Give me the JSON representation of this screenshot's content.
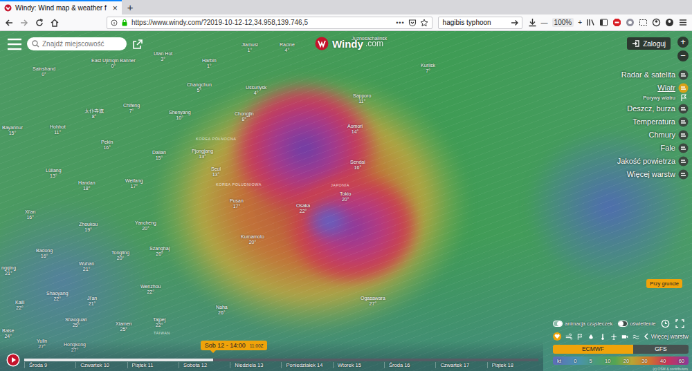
{
  "browser": {
    "tab": {
      "title": "Windy: Wind map & weather f",
      "close": "×",
      "selected": true
    },
    "new_tab": "+",
    "url": "https://www.windy.com/?2019-10-12-12,34.958,139.746,5",
    "page_actions": "•••",
    "search": "hagibis typhoon",
    "zoom_out": "—",
    "zoom_level": "100%",
    "zoom_in": "+"
  },
  "app": {
    "search_placeholder": "Znajdź miejscowość",
    "logo": "Windy",
    "logo_suffix": ".com",
    "login": "Zaloguj",
    "zoom": [
      "+",
      "−"
    ],
    "layers": [
      {
        "label": "Radar & satelita",
        "selected": false,
        "kind": "main"
      },
      {
        "label": "Wiatr",
        "selected": true,
        "kind": "main"
      },
      {
        "label": "Porywy wiatru",
        "selected": false,
        "kind": "sub"
      },
      {
        "label": "Deszcz, burza",
        "selected": false,
        "kind": "main"
      },
      {
        "label": "Temperatura",
        "selected": false,
        "kind": "main"
      },
      {
        "label": "Chmury",
        "selected": false,
        "kind": "main"
      },
      {
        "label": "Fale",
        "selected": false,
        "kind": "main"
      },
      {
        "label": "Jakość powietrza",
        "selected": false,
        "kind": "main"
      },
      {
        "label": "Więcej warstw",
        "selected": false,
        "kind": "main"
      }
    ],
    "level_button": "Przy gruncie",
    "toggles": [
      {
        "label": "animacja cząsteczek",
        "on": true
      },
      {
        "label": "oświetlenie",
        "on": false
      }
    ],
    "more_layers": "Więcej warstw",
    "models": [
      {
        "label": "ECMWF",
        "selected": true
      },
      {
        "label": "GFS",
        "selected": false
      }
    ],
    "legend": {
      "unit": "kt",
      "ticks": [
        "0",
        "5",
        "10",
        "20",
        "30",
        "40",
        "60"
      ]
    },
    "copyright": "(c) OSM & contributors"
  },
  "timeline": {
    "bubble": "Sob 12 - 14:00",
    "bubble_utc": "11:00Z",
    "level": 0.367,
    "days": [
      "Środa 9",
      "Czwartek 10",
      "Piątek 11",
      "Sobota 12",
      "Niedziela 13",
      "Poniedziałek 14",
      "Wtorek 15",
      "Środa 16",
      "Czwartek 17",
      "Piątek 18"
    ]
  },
  "map": {
    "regions": [
      "KOREA PÓŁNOCNA",
      "KOREA POŁUDNIOWA",
      "JAPONIA",
      "TAIWAN"
    ],
    "cities": [
      {
        "name": "Sainshand",
        "temp": "0°"
      },
      {
        "name": "East Ujimqin Banner",
        "temp": "0°"
      },
      {
        "name": "Ulan Hot",
        "temp": "3°"
      },
      {
        "name": "Harbin",
        "temp": "1°"
      },
      {
        "name": "Jiamusi",
        "temp": "1°"
      },
      {
        "name": "Racine",
        "temp": "4°"
      },
      {
        "name": "Juznosachalinsk",
        "temp": ""
      },
      {
        "name": "Kurilsk",
        "temp": "7°"
      },
      {
        "name": "Changchun",
        "temp": "5°"
      },
      {
        "name": "Ussuriysk",
        "temp": "4°"
      },
      {
        "name": "Sapporo",
        "temp": "11°"
      },
      {
        "name": "太仆寺旗",
        "temp": "8°"
      },
      {
        "name": "Chifeng",
        "temp": "7°"
      },
      {
        "name": "Shenyang",
        "temp": "10°"
      },
      {
        "name": "Chongjin",
        "temp": "8°"
      },
      {
        "name": "Bayannur",
        "temp": "15°"
      },
      {
        "name": "Hohhot",
        "temp": "11°"
      },
      {
        "name": "Pekin",
        "temp": "16°"
      },
      {
        "name": "Aomori",
        "temp": "14°"
      },
      {
        "name": "Dalian",
        "temp": "15°"
      },
      {
        "name": "Pjongjang",
        "temp": "13°"
      },
      {
        "name": "Sendai",
        "temp": "16°"
      },
      {
        "name": "Lüliang",
        "temp": "13°"
      },
      {
        "name": "Seul",
        "temp": "13°"
      },
      {
        "name": "Handan",
        "temp": "18°"
      },
      {
        "name": "Weifang",
        "temp": "17°"
      },
      {
        "name": "Tokio",
        "temp": "20°"
      },
      {
        "name": "Pusan",
        "temp": "17°"
      },
      {
        "name": "Osaka",
        "temp": "22°"
      },
      {
        "name": "Xi'an",
        "temp": "16°"
      },
      {
        "name": "Zhoukou",
        "temp": "19°"
      },
      {
        "name": "Yancheng",
        "temp": "20°"
      },
      {
        "name": "Kumamoto",
        "temp": "20°"
      },
      {
        "name": "Szanghaj",
        "temp": "20°"
      },
      {
        "name": "Badong",
        "temp": "16°"
      },
      {
        "name": "Tongling",
        "temp": "20°"
      },
      {
        "name": "Wuhan",
        "temp": "21°"
      },
      {
        "name": "ngqing",
        "temp": "21°"
      },
      {
        "name": "Wenzhou",
        "temp": "22°"
      },
      {
        "name": "Naha",
        "temp": "26°"
      },
      {
        "name": "Ogasawara",
        "temp": "27°"
      },
      {
        "name": "Kaili",
        "temp": "22°"
      },
      {
        "name": "Shaoyang",
        "temp": "22°"
      },
      {
        "name": "Ji'an",
        "temp": "21°"
      },
      {
        "name": "Shaoguan",
        "temp": "25°"
      },
      {
        "name": "Xiamen",
        "temp": "25°"
      },
      {
        "name": "Tajpej",
        "temp": "22°"
      },
      {
        "name": "Baise",
        "temp": "24°"
      },
      {
        "name": "Yulin",
        "temp": "27°"
      },
      {
        "name": "Hongkong",
        "temp": "27°"
      }
    ]
  }
}
